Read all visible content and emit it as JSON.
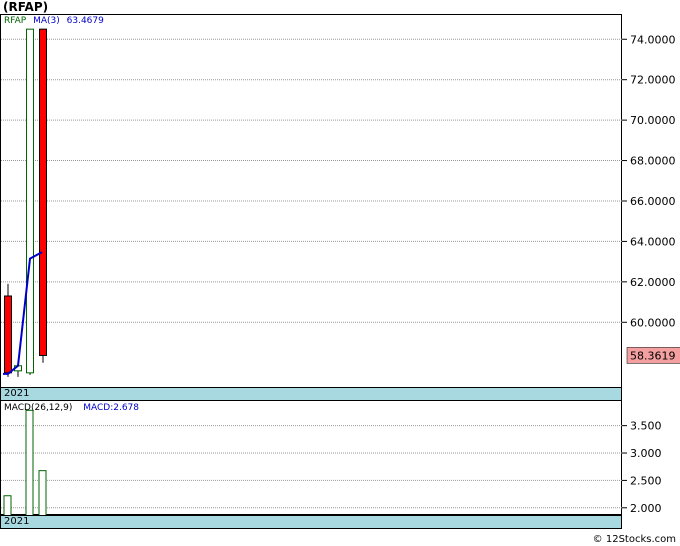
{
  "header": {
    "title": "(RFAP)"
  },
  "legend": {
    "ticker": "RFAP",
    "ma_label": "MA(3)",
    "ma_value": "63.4679",
    "macd_label": "MACD(26,12,9)",
    "macd_value": "MACD:2.678"
  },
  "last_price_label": "58.3619",
  "date_label_main": "2021",
  "date_label_macd": "2021",
  "credit": "© 12Stocks.com",
  "colors": {
    "up": "#006400",
    "down": "#ff0000",
    "ma": "#0000cc",
    "grid": "#999999",
    "strip": "#a8d8e0",
    "price_box": "#f4a0a0"
  },
  "chart_data": [
    {
      "type": "candlestick",
      "title": "",
      "ylim": [
        56.7,
        75.2
      ],
      "yticks": [
        60.0,
        62.0,
        64.0,
        66.0,
        68.0,
        70.0,
        72.0,
        74.0
      ],
      "ytick_labels": [
        "60.0000",
        "62.0000",
        "64.0000",
        "66.0000",
        "68.0000",
        "70.0000",
        "72.0000",
        "74.0000"
      ],
      "candles": [
        {
          "open": 61.3,
          "high": 61.9,
          "low": 57.3,
          "close": 57.5,
          "direction": "down"
        },
        {
          "open": 57.6,
          "high": 57.9,
          "low": 57.3,
          "close": 57.85,
          "direction": "up"
        },
        {
          "open": 57.5,
          "high": 74.5,
          "low": 57.4,
          "close": 74.5,
          "direction": "up"
        },
        {
          "open": 74.5,
          "high": 74.5,
          "low": 58.0,
          "close": 58.36,
          "direction": "down"
        }
      ],
      "ma_series": {
        "name": "MA(3)",
        "values": [
          57.45,
          57.85,
          63.15,
          63.47
        ]
      },
      "last_value": 58.3619,
      "xlabel": "2021"
    },
    {
      "type": "bar",
      "title": "",
      "ylim": [
        1.85,
        3.95
      ],
      "yticks": [
        2.0,
        2.5,
        3.0,
        3.5
      ],
      "ytick_labels": [
        "2.000",
        "2.500",
        "3.000",
        "3.500"
      ],
      "values": [
        2.22,
        3.78,
        2.678
      ],
      "positions": [
        0,
        2,
        3
      ],
      "series_name": "MACD(26,12,9)",
      "xlabel": "2021"
    }
  ]
}
